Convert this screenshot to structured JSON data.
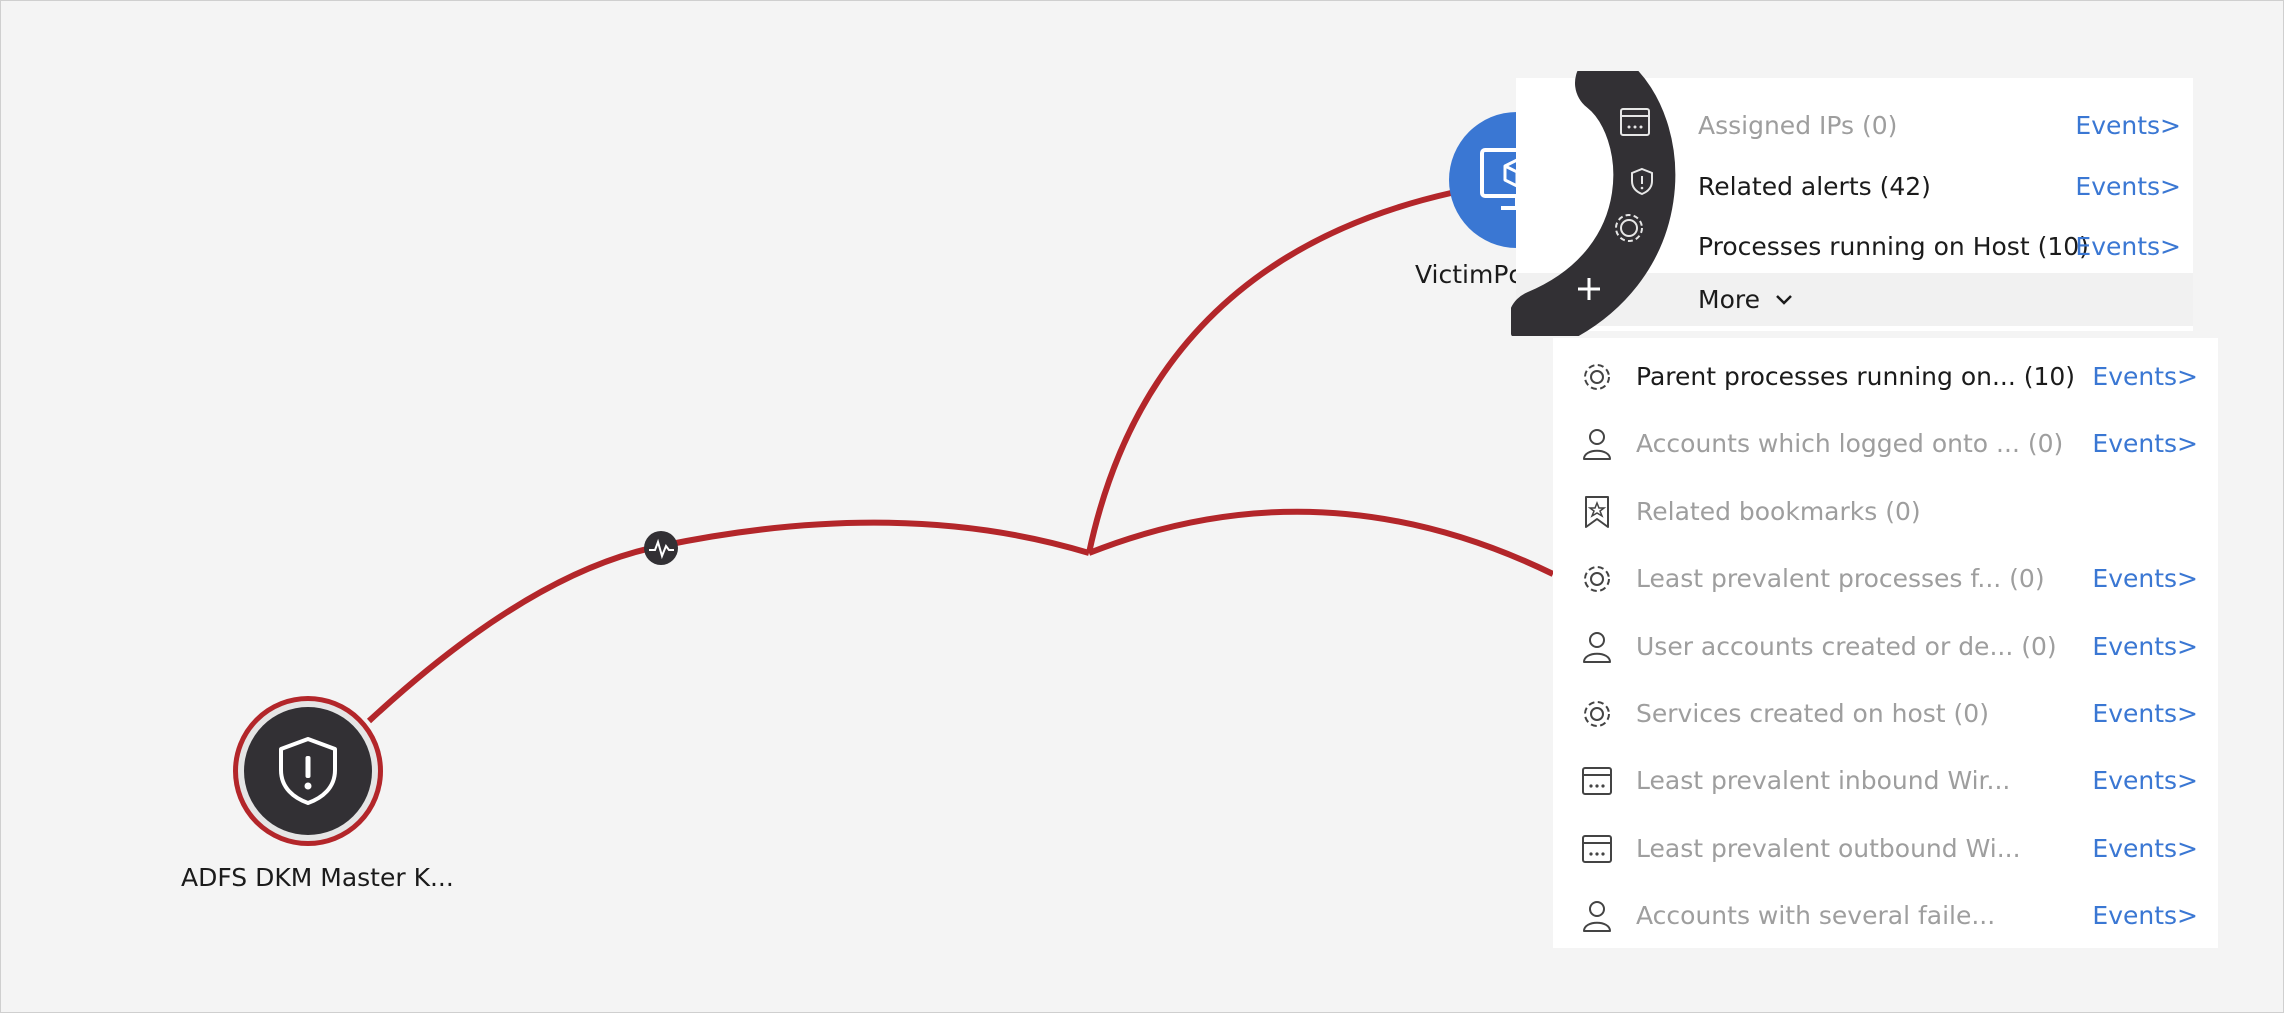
{
  "colors": {
    "background": "#f4f4f4",
    "edge": "#b3262a",
    "host_node": "#3a77d3",
    "alert_node": "#323034",
    "arc_menu": "#323034",
    "link": "#3a77d3",
    "text_active": "#1b1b1b",
    "text_muted": "#9e9e9e"
  },
  "nodes": {
    "alert": {
      "label": "ADFS DKM Master K...",
      "icon": "shield-exclamation-icon"
    },
    "host": {
      "label": "VictimPc",
      "icon": "monitor-cube-icon"
    }
  },
  "edge_marker": {
    "icon": "activity-pulse-icon"
  },
  "arc_menu": {
    "icons": [
      "window-icon",
      "shield-alert-icon",
      "gear-icon",
      "plus-icon"
    ]
  },
  "primary_menu": {
    "items": [
      {
        "label": "Assigned IPs (0)",
        "events": "Events>",
        "state": "muted"
      },
      {
        "label": "Related alerts (42)",
        "events": "Events>",
        "state": "active"
      },
      {
        "label": "Processes running on Host (10)",
        "events": "Events>",
        "state": "active"
      }
    ],
    "more": {
      "label": "More",
      "icon": "chevron-down-icon"
    }
  },
  "more_menu": {
    "items": [
      {
        "label": "Parent processes running on... (10)",
        "events": "Events>",
        "icon": "gear-icon",
        "state": "active"
      },
      {
        "label": "Accounts which logged onto ... (0)",
        "events": "Events>",
        "icon": "person-icon",
        "state": "muted"
      },
      {
        "label": "Related bookmarks (0)",
        "events": "",
        "icon": "bookmark-star-icon",
        "state": "muted"
      },
      {
        "label": "Least prevalent processes f... (0)",
        "events": "Events>",
        "icon": "gear-icon",
        "state": "muted"
      },
      {
        "label": "User accounts created or de... (0)",
        "events": "Events>",
        "icon": "person-icon",
        "state": "muted"
      },
      {
        "label": "Services created on host (0)",
        "events": "Events>",
        "icon": "gear-icon",
        "state": "muted"
      },
      {
        "label": "Least prevalent inbound Wir...",
        "events": "Events>",
        "icon": "window-icon",
        "state": "muted"
      },
      {
        "label": "Least prevalent outbound Wi...",
        "events": "Events>",
        "icon": "window-icon",
        "state": "muted"
      },
      {
        "label": "Accounts with several faile...",
        "events": "Events>",
        "icon": "person-icon",
        "state": "muted"
      }
    ]
  }
}
